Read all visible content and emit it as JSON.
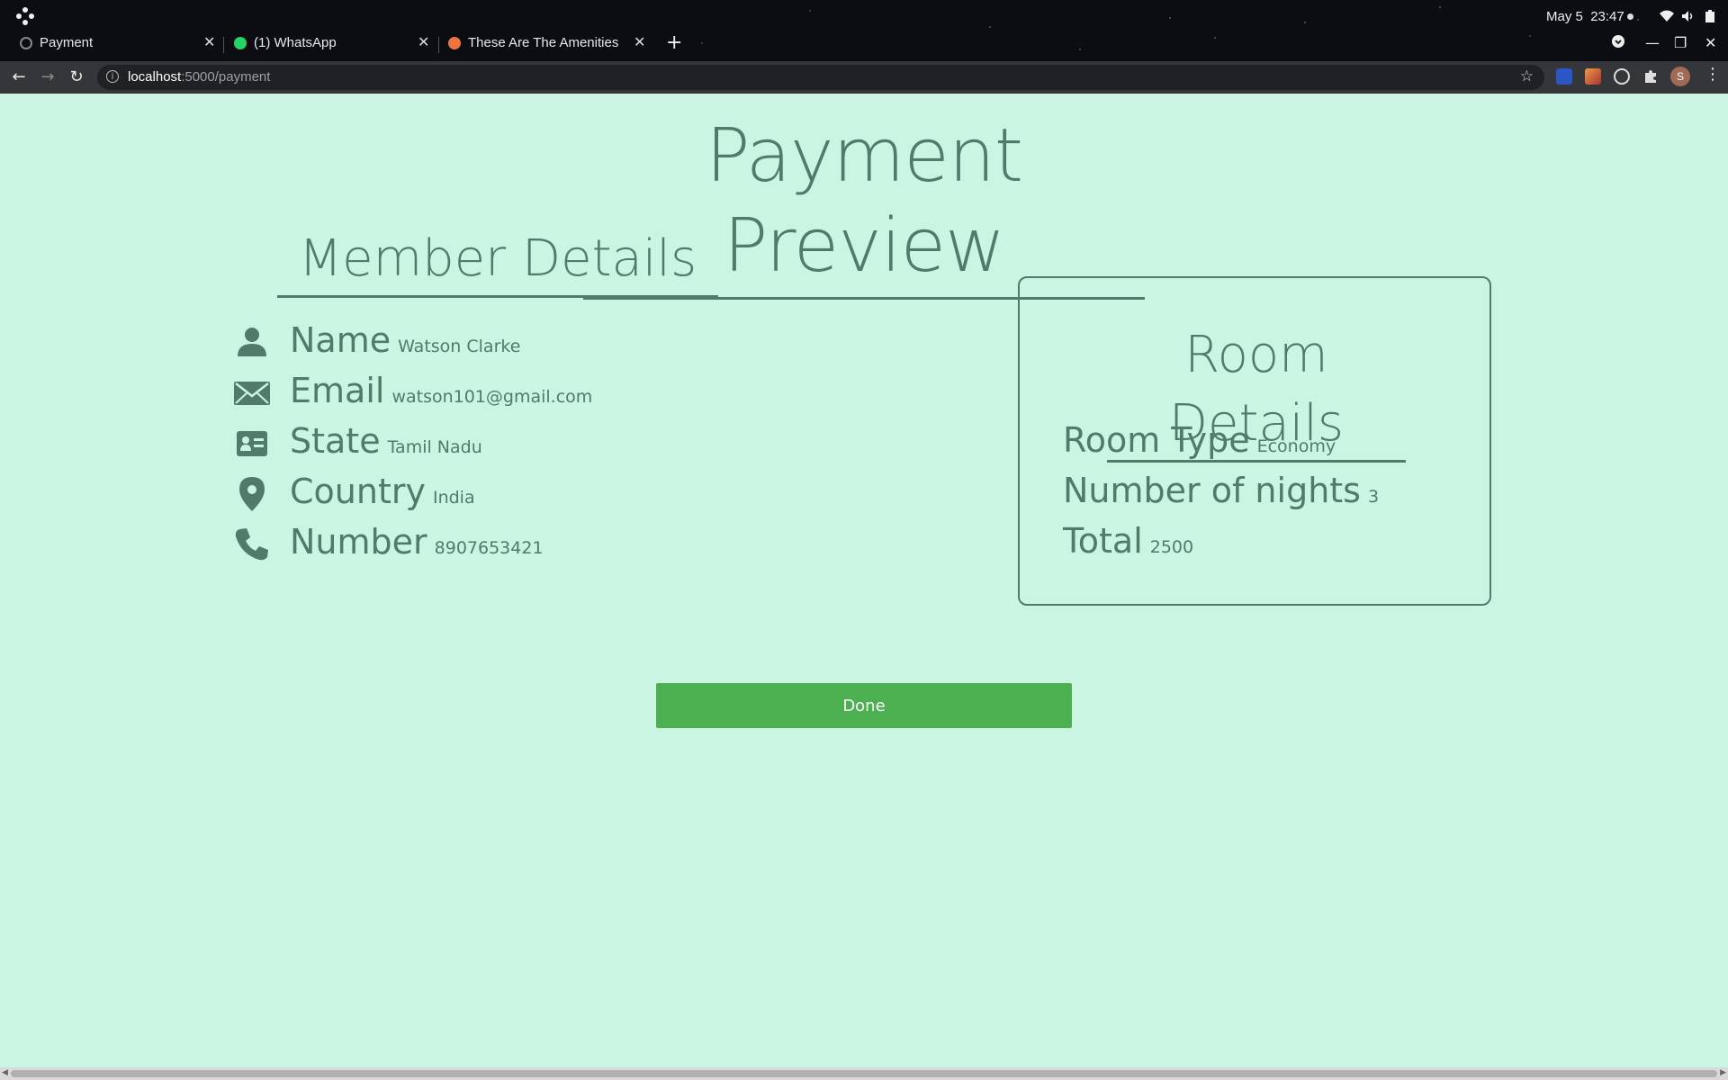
{
  "system": {
    "date": "May 5",
    "time": "23:47"
  },
  "tabs": [
    {
      "title": "Payment",
      "favicon_color": "#777777"
    },
    {
      "title": "(1) WhatsApp",
      "favicon_color": "#25d366"
    },
    {
      "title": "These Are The Amenities",
      "favicon_color": "#f0743e"
    }
  ],
  "addressbar": {
    "host": "localhost",
    "rest": ":5000/payment"
  },
  "page": {
    "title": "Payment Preview",
    "member": {
      "heading": "Member Details",
      "rows": [
        {
          "icon": "person-icon",
          "label": "Name",
          "value": "Watson Clarke"
        },
        {
          "icon": "envelope-icon",
          "label": "Email",
          "value": "watson101@gmail.com"
        },
        {
          "icon": "id-card-icon",
          "label": "State",
          "value": "Tamil Nadu"
        },
        {
          "icon": "map-pin-icon",
          "label": "Country",
          "value": "India"
        },
        {
          "icon": "phone-icon",
          "label": "Number",
          "value": "8907653421"
        }
      ]
    },
    "room": {
      "heading": "Room Details",
      "rows": [
        {
          "label": "Room Type",
          "value": "Economy"
        },
        {
          "label": "Number of nights",
          "value": "3"
        },
        {
          "label": "Total",
          "value": "2500"
        }
      ]
    },
    "done_label": "Done"
  },
  "colors": {
    "background": "#c9f5e2",
    "text": "#527a6b",
    "button": "#4caf50"
  }
}
